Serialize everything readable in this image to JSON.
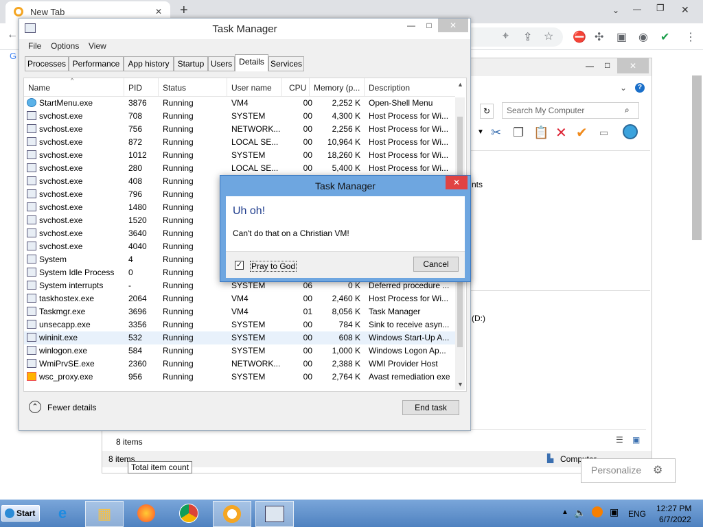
{
  "chrome": {
    "tab_title": "New Tab",
    "tab_close": "✕",
    "new_tab": "+",
    "minimize": "—",
    "restore": "❐",
    "close": "✕"
  },
  "explorer": {
    "search_placeholder": "Search My Computer",
    "partial_text_1": "nts",
    "partial_text_2": "(D:)",
    "status_items": "8 items",
    "details_items": "8 items",
    "location": "Computer",
    "tooltip": "Total item count",
    "personalize": "Personalize"
  },
  "task_manager": {
    "title": "Task Manager",
    "menu": [
      "File",
      "Options",
      "View"
    ],
    "tabs": [
      "Processes",
      "Performance",
      "App history",
      "Startup",
      "Users",
      "Details",
      "Services"
    ],
    "selected_tab": "Details",
    "columns": [
      "Name",
      "PID",
      "Status",
      "User name",
      "CPU",
      "Memory (p...",
      "Description"
    ],
    "rows": [
      {
        "name": "StartMenu.exe",
        "pid": "3876",
        "status": "Running",
        "user": "VM4",
        "cpu": "00",
        "mem": "2,252 K",
        "desc": "Open-Shell Menu",
        "icon": "globe"
      },
      {
        "name": "svchost.exe",
        "pid": "708",
        "status": "Running",
        "user": "SYSTEM",
        "cpu": "00",
        "mem": "4,300 K",
        "desc": "Host Process for Wi...",
        "icon": "window"
      },
      {
        "name": "svchost.exe",
        "pid": "756",
        "status": "Running",
        "user": "NETWORK...",
        "cpu": "00",
        "mem": "2,256 K",
        "desc": "Host Process for Wi...",
        "icon": "window"
      },
      {
        "name": "svchost.exe",
        "pid": "872",
        "status": "Running",
        "user": "LOCAL SE...",
        "cpu": "00",
        "mem": "10,964 K",
        "desc": "Host Process for Wi...",
        "icon": "window"
      },
      {
        "name": "svchost.exe",
        "pid": "1012",
        "status": "Running",
        "user": "SYSTEM",
        "cpu": "00",
        "mem": "18,260 K",
        "desc": "Host Process for Wi...",
        "icon": "window"
      },
      {
        "name": "svchost.exe",
        "pid": "280",
        "status": "Running",
        "user": "LOCAL SE...",
        "cpu": "00",
        "mem": "5,400 K",
        "desc": "Host Process for Wi...",
        "icon": "window"
      },
      {
        "name": "svchost.exe",
        "pid": "408",
        "status": "Running",
        "user": "",
        "cpu": "",
        "mem": "",
        "desc": "",
        "icon": "window"
      },
      {
        "name": "svchost.exe",
        "pid": "796",
        "status": "Running",
        "user": "",
        "cpu": "",
        "mem": "",
        "desc": "",
        "icon": "window"
      },
      {
        "name": "svchost.exe",
        "pid": "1480",
        "status": "Running",
        "user": "",
        "cpu": "",
        "mem": "",
        "desc": "",
        "icon": "window"
      },
      {
        "name": "svchost.exe",
        "pid": "1520",
        "status": "Running",
        "user": "",
        "cpu": "",
        "mem": "",
        "desc": "",
        "icon": "window"
      },
      {
        "name": "svchost.exe",
        "pid": "3640",
        "status": "Running",
        "user": "",
        "cpu": "",
        "mem": "",
        "desc": "",
        "icon": "window"
      },
      {
        "name": "svchost.exe",
        "pid": "4040",
        "status": "Running",
        "user": "",
        "cpu": "",
        "mem": "",
        "desc": "",
        "icon": "window"
      },
      {
        "name": "System",
        "pid": "4",
        "status": "Running",
        "user": "",
        "cpu": "",
        "mem": "",
        "desc": "",
        "icon": "window"
      },
      {
        "name": "System Idle Process",
        "pid": "0",
        "status": "Running",
        "user": "",
        "cpu": "",
        "mem": "",
        "desc": "",
        "icon": "window"
      },
      {
        "name": "System interrupts",
        "pid": "-",
        "status": "Running",
        "user": "SYSTEM",
        "cpu": "06",
        "mem": "0 K",
        "desc": "Deferred procedure ...",
        "icon": "window"
      },
      {
        "name": "taskhostex.exe",
        "pid": "2064",
        "status": "Running",
        "user": "VM4",
        "cpu": "00",
        "mem": "2,460 K",
        "desc": "Host Process for Wi...",
        "icon": "window"
      },
      {
        "name": "Taskmgr.exe",
        "pid": "3696",
        "status": "Running",
        "user": "VM4",
        "cpu": "01",
        "mem": "8,056 K",
        "desc": "Task Manager",
        "icon": "window"
      },
      {
        "name": "unsecapp.exe",
        "pid": "3356",
        "status": "Running",
        "user": "SYSTEM",
        "cpu": "00",
        "mem": "784 K",
        "desc": "Sink to receive asyn...",
        "icon": "window"
      },
      {
        "name": "wininit.exe",
        "pid": "532",
        "status": "Running",
        "user": "SYSTEM",
        "cpu": "00",
        "mem": "608 K",
        "desc": "Windows Start-Up A...",
        "icon": "window",
        "selected": true
      },
      {
        "name": "winlogon.exe",
        "pid": "584",
        "status": "Running",
        "user": "SYSTEM",
        "cpu": "00",
        "mem": "1,000 K",
        "desc": "Windows Logon Ap...",
        "icon": "window"
      },
      {
        "name": "WmiPrvSE.exe",
        "pid": "2360",
        "status": "Running",
        "user": "NETWORK...",
        "cpu": "00",
        "mem": "2,388 K",
        "desc": "WMI Provider Host",
        "icon": "window"
      },
      {
        "name": "wsc_proxy.exe",
        "pid": "956",
        "status": "Running",
        "user": "SYSTEM",
        "cpu": "00",
        "mem": "2,764 K",
        "desc": "Avast remediation exe",
        "icon": "avast"
      }
    ],
    "fewer_details": "Fewer details",
    "end_task": "End task"
  },
  "dialog": {
    "title": "Task Manager",
    "heading": "Uh oh!",
    "message": "Can't do that on a Christian VM!",
    "checkbox_label": "Pray to God",
    "checkbox_checked": true,
    "cancel": "Cancel"
  },
  "taskbar": {
    "start": "Start",
    "language": "ENG",
    "time": "12:27 PM",
    "date": "6/7/2022"
  },
  "colors": {
    "taskbar": "#5b8cc6",
    "dialog_frame": "#6ea6e0",
    "close_red": "#e04343",
    "selected_row": "#e8f1fb"
  }
}
